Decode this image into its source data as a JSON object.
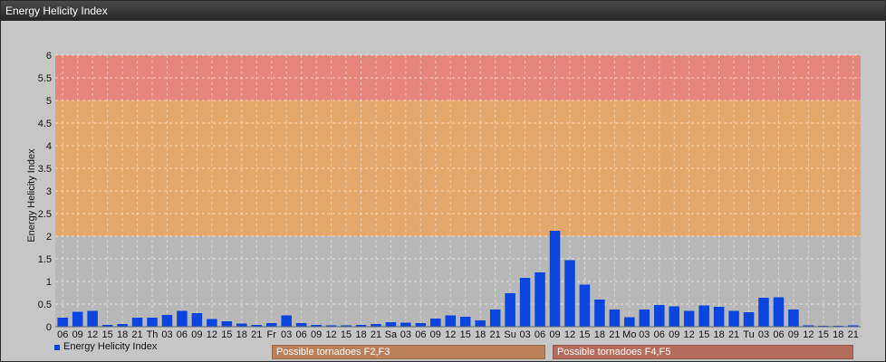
{
  "window": {
    "title": "Energy Helicity Index"
  },
  "legend": {
    "label": "Energy Helicity Index",
    "color": "#0a45e0"
  },
  "bands": {
    "f23": {
      "label": "Possible tornadoes F2,F3"
    },
    "f45": {
      "label": "Possible tornadoes F4,F5"
    }
  },
  "colors": {
    "bar": "#0a45e0",
    "zone_low": "#e4a86c",
    "zone_high": "#e4877a",
    "plot_bg": "#b8b8b8"
  },
  "chart_data": {
    "type": "bar",
    "ylabel": "Energy Helicity Index",
    "ylim": [
      0,
      6
    ],
    "yticks": [
      "0",
      "0.5",
      "1",
      "1.5",
      "2",
      "2.5",
      "3",
      "3.5",
      "4",
      "4.5",
      "5",
      "5.5",
      "6"
    ],
    "grid": true,
    "zones": [
      {
        "from": 2,
        "to": 5,
        "label": "Possible tornadoes F2,F3"
      },
      {
        "from": 5,
        "to": 6,
        "label": "Possible tornadoes F4,F5"
      }
    ],
    "categories": [
      "06",
      "09",
      "12",
      "15",
      "18",
      "21",
      "Th",
      "03",
      "06",
      "09",
      "12",
      "15",
      "18",
      "21",
      "Fr",
      "03",
      "06",
      "09",
      "12",
      "15",
      "18",
      "21",
      "Sa",
      "03",
      "06",
      "09",
      "12",
      "15",
      "18",
      "21",
      "Su",
      "03",
      "06",
      "09",
      "12",
      "15",
      "18",
      "21",
      "Mo",
      "03",
      "06",
      "09",
      "12",
      "15",
      "18",
      "21",
      "Tu",
      "03",
      "06",
      "09",
      "12",
      "15",
      "18",
      "21"
    ],
    "series": [
      {
        "name": "Energy Helicity Index",
        "values": [
          0.2,
          0.33,
          0.35,
          0.04,
          0.06,
          0.2,
          0.2,
          0.26,
          0.35,
          0.3,
          0.17,
          0.12,
          0.07,
          0.04,
          0.08,
          0.25,
          0.08,
          0.04,
          0.03,
          0.03,
          0.04,
          0.06,
          0.1,
          0.09,
          0.08,
          0.18,
          0.25,
          0.22,
          0.14,
          0.38,
          0.74,
          1.08,
          1.2,
          2.12,
          1.47,
          0.93,
          0.6,
          0.38,
          0.21,
          0.38,
          0.48,
          0.45,
          0.35,
          0.47,
          0.44,
          0.35,
          0.32,
          0.64,
          0.65,
          0.38,
          0.03,
          0.02,
          0.02,
          0.03
        ]
      }
    ]
  }
}
